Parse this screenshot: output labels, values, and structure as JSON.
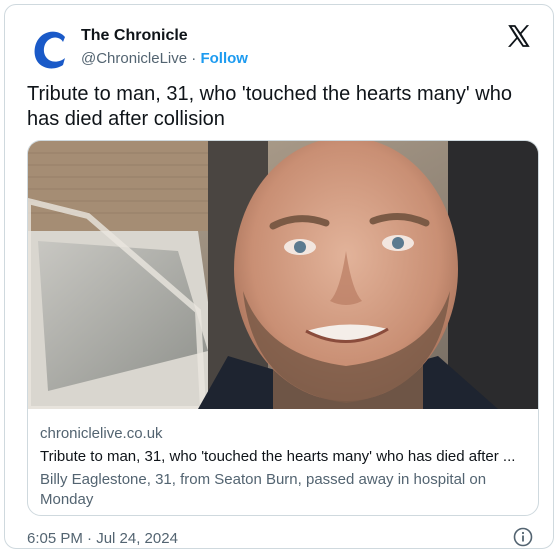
{
  "author": {
    "name": "The Chronicle",
    "handle": "@ChronicleLive",
    "separator": " · ",
    "follow_label": "Follow",
    "avatar_letter": "C"
  },
  "tweet": {
    "text": "Tribute to man, 31, who 'touched the hearts many' who has died after collision",
    "timestamp": "6:05 PM · Jul 24, 2024"
  },
  "link_card": {
    "domain": "chroniclelive.co.uk",
    "title": "Tribute to man, 31, who 'touched the hearts many' who has died after ...",
    "description": "Billy Eaglestone, 31, from Seaton Burn, passed away in hospital on Monday"
  },
  "icons": {
    "brand": "x-logo-icon",
    "info": "info-icon"
  },
  "colors": {
    "link_blue": "#1d9bf0",
    "secondary_text": "#536471",
    "border": "#cfd9de",
    "brand_blue": "#1a5ac8"
  }
}
